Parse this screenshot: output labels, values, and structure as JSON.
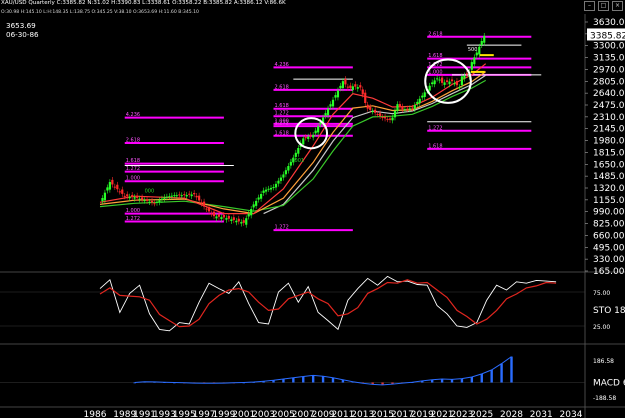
{
  "toolbar": {
    "title": "XAU/USD  Quarterly  C:3385.82  N:31.02  H:3390.83  L:3338.61  O:3358.22  B:3385.82  A:3386.12  V:86.6K",
    "ohlc_strip": "O:30.98  H:145.10  L:H:148.35  L:138.75  O:345.25  V:38.10  O:3653.69  H:11.60  B:345.10",
    "window_buttons": [
      "–",
      "□",
      "×"
    ]
  },
  "corner_labels": {
    "high_value": "3653.69",
    "date": "06-30-86"
  },
  "colors": {
    "background": "#000000",
    "candle_up": "#27ff27",
    "candle_down": "#ff2a2a",
    "fib_level": "#ff00ff",
    "fib_text": "#ff55ff",
    "ma_red": "#ff3b3b",
    "ma_orange": "#ffa13b",
    "ma_green": "#39c82a",
    "ma_white": "#c8c8c8",
    "osc_line": "#ffffff",
    "osc_signal": "#e0261f",
    "macd_up": "#2a6cff",
    "macd_down": "#d83232",
    "price_flag": "#ffffff",
    "yellow_marker": "#ffe400",
    "green_label": "#29d929",
    "grid": "#5a5a5a"
  },
  "chart_data": [
    {
      "type": "candlestick",
      "panel": "price",
      "y_scale": "log",
      "ylim": [
        140,
        3900
      ],
      "yticks": [
        "3630.00",
        "3465.00",
        "3300.00",
        "3135.00",
        "2970.00",
        "2805.00",
        "2640.00",
        "2475.00",
        "2310.00",
        "2145.00",
        "1980.00",
        "1815.00",
        "1650.00",
        "1485.00",
        "1320.00",
        "1155.00",
        "990.00",
        "825.00",
        "660.00",
        "495.00",
        "330.00",
        "165.00"
      ],
      "last_price_label": "3385.82",
      "x_range": [
        1986.5,
        2035
      ],
      "xticks": [
        "1986",
        "1989",
        "1991",
        "1993",
        "1995",
        "1997",
        "1999",
        "2001",
        "2003",
        "2005",
        "2007",
        "2009",
        "2011",
        "2013",
        "2015",
        "2017",
        "2019",
        "2021",
        "2023",
        "2025",
        "2028",
        "2031",
        "2034"
      ],
      "price_path": [
        [
          1986.5,
          345
        ],
        [
          1987.5,
          460
        ],
        [
          1988.2,
          420
        ],
        [
          1989,
          380
        ],
        [
          1990,
          375
        ],
        [
          1991,
          360
        ],
        [
          1992,
          345
        ],
        [
          1993,
          375
        ],
        [
          1994,
          385
        ],
        [
          1995,
          385
        ],
        [
          1996,
          390
        ],
        [
          1997,
          330
        ],
        [
          1998,
          290
        ],
        [
          1999,
          285
        ],
        [
          2000,
          275
        ],
        [
          2001,
          265
        ],
        [
          2002,
          340
        ],
        [
          2003,
          410
        ],
        [
          2004,
          430
        ],
        [
          2005,
          510
        ],
        [
          2006,
          640
        ],
        [
          2007,
          830
        ],
        [
          2008,
          870
        ],
        [
          2009,
          1100
        ],
        [
          2010,
          1400
        ],
        [
          2011,
          1800
        ],
        [
          2011.6,
          1620
        ],
        [
          2012,
          1680
        ],
        [
          2012.8,
          1650
        ],
        [
          2013.4,
          1250
        ],
        [
          2014,
          1200
        ],
        [
          2015,
          1100
        ],
        [
          2015.9,
          1060
        ],
        [
          2016.5,
          1320
        ],
        [
          2017,
          1230
        ],
        [
          2018,
          1250
        ],
        [
          2019,
          1480
        ],
        [
          2020,
          1770
        ],
        [
          2020.6,
          1890
        ],
        [
          2021,
          1760
        ],
        [
          2022,
          1800
        ],
        [
          2022.8,
          1650
        ],
        [
          2023,
          1920
        ],
        [
          2023.7,
          1990
        ],
        [
          2024,
          2330
        ],
        [
          2024.5,
          2650
        ],
        [
          2025,
          3100
        ],
        [
          2025.2,
          3300
        ],
        [
          2025.4,
          3385.82
        ]
      ],
      "ma_red": [
        [
          1986.5,
          350
        ],
        [
          1990,
          380
        ],
        [
          1995,
          370
        ],
        [
          1999,
          300
        ],
        [
          2002,
          300
        ],
        [
          2005,
          420
        ],
        [
          2008,
          750
        ],
        [
          2010,
          1150
        ],
        [
          2012,
          1520
        ],
        [
          2014,
          1430
        ],
        [
          2016,
          1270
        ],
        [
          2018,
          1280
        ],
        [
          2020,
          1450
        ],
        [
          2022,
          1720
        ],
        [
          2024,
          1960
        ],
        [
          2025.4,
          2280
        ]
      ],
      "ma_orange": [
        [
          1986.5,
          340
        ],
        [
          1990,
          360
        ],
        [
          1995,
          365
        ],
        [
          1999,
          320
        ],
        [
          2002,
          300
        ],
        [
          2005,
          370
        ],
        [
          2008,
          600
        ],
        [
          2010,
          900
        ],
        [
          2012,
          1250
        ],
        [
          2014,
          1290
        ],
        [
          2016,
          1210
        ],
        [
          2018,
          1220
        ],
        [
          2020,
          1370
        ],
        [
          2022,
          1580
        ],
        [
          2024,
          1790
        ],
        [
          2025.4,
          2050
        ]
      ],
      "ma_green": [
        [
          1986.5,
          330
        ],
        [
          1990,
          345
        ],
        [
          1995,
          355
        ],
        [
          1999,
          330
        ],
        [
          2002,
          310
        ],
        [
          2005,
          335
        ],
        [
          2008,
          480
        ],
        [
          2010,
          700
        ],
        [
          2012,
          980
        ],
        [
          2014,
          1110
        ],
        [
          2016,
          1120
        ],
        [
          2018,
          1150
        ],
        [
          2020,
          1280
        ],
        [
          2022,
          1460
        ],
        [
          2024,
          1640
        ],
        [
          2025.4,
          1820
        ]
      ],
      "ma_white": [
        [
          2003,
          300
        ],
        [
          2005,
          340
        ],
        [
          2008,
          540
        ],
        [
          2010,
          800
        ],
        [
          2012,
          1100
        ],
        [
          2014,
          1200
        ],
        [
          2016,
          1160
        ],
        [
          2018,
          1200
        ],
        [
          2020,
          1330
        ],
        [
          2022,
          1520
        ],
        [
          2024,
          1720
        ],
        [
          2025.4,
          1950
        ]
      ],
      "fib_levels_left": [
        {
          "label": "4.236",
          "price": 1100,
          "x0": 1989,
          "x1": 1999
        },
        {
          "label": "2.618",
          "price": 780,
          "x0": 1989,
          "x1": 1999
        },
        {
          "label": "1.618",
          "price": 590,
          "x0": 1989,
          "x1": 1999
        },
        {
          "label": "1.272",
          "price": 530,
          "x0": 1989,
          "x1": 1999
        },
        {
          "label": "1.000",
          "price": 465,
          "x0": 1989,
          "x1": 1999
        },
        {
          "label": "1.000",
          "price": 300,
          "x0": 1989,
          "x1": 1999
        },
        {
          "label": "1.272",
          "price": 270,
          "x0": 1989,
          "x1": 1999
        }
      ],
      "fib_levels_mid": [
        {
          "label": "4.236",
          "price": 2170,
          "x0": 2004,
          "x1": 2012
        },
        {
          "label": "2.618",
          "price": 1600,
          "x0": 2004,
          "x1": 2012
        },
        {
          "label": "1.618",
          "price": 1240,
          "x0": 2004,
          "x1": 2012
        },
        {
          "label": "1.272",
          "price": 1120,
          "x0": 2004,
          "x1": 2012
        },
        {
          "label": "1.000",
          "price": 1010,
          "x0": 2004,
          "x1": 2012
        },
        {
          "label": "1.272",
          "price": 980,
          "x0": 2004,
          "x1": 2012
        },
        {
          "label": "1.618",
          "price": 860,
          "x0": 2004,
          "x1": 2012
        },
        {
          "label": "1.272",
          "price": 240,
          "x0": 2004,
          "x1": 2012
        }
      ],
      "fib_levels_right": [
        {
          "label": "2.618",
          "price": 3280,
          "x0": 2019.5,
          "x1": 2030
        },
        {
          "label": "1.618",
          "price": 2440,
          "x0": 2019.5,
          "x1": 2030
        },
        {
          "label": "1.272",
          "price": 2170,
          "x0": 2019.5,
          "x1": 2030
        },
        {
          "label": "1.000",
          "price": 1960,
          "x0": 2019.5,
          "x1": 2030
        },
        {
          "label": "1.272",
          "price": 920,
          "x0": 2019.5,
          "x1": 2030
        },
        {
          "label": "1.618",
          "price": 720,
          "x0": 2019.5,
          "x1": 2030
        }
      ],
      "white_levels": [
        {
          "label": "500",
          "price": 2930,
          "x0": 2023.5,
          "x1": 2029
        },
        {
          "label": "",
          "price": 1960,
          "x0": 2022,
          "x1": 2031
        },
        {
          "label": "",
          "price": 1040,
          "x0": 2019.5,
          "x1": 2030
        },
        {
          "label": "",
          "price": 1850,
          "x0": 2006,
          "x1": 2012
        },
        {
          "label": "",
          "price": 575,
          "x0": 1989,
          "x1": 2000
        }
      ],
      "green_labels": [
        {
          "text": "000",
          "year": 1991,
          "price": 400
        },
        {
          "text": "0001",
          "year": 2005.8,
          "price": 605
        }
      ],
      "circles": [
        {
          "year": 2007.8,
          "price": 890,
          "rx_years": 1.6
        },
        {
          "year": 2021.6,
          "price": 1800,
          "rx_years": 2.3
        }
      ],
      "yellow_markers": [
        {
          "year": 2024.8,
          "price": 2560
        },
        {
          "year": 2023.9,
          "price": 2040
        }
      ]
    },
    {
      "type": "line",
      "panel": "stochastic",
      "label": "STO 18",
      "ylim": [
        0,
        100
      ],
      "levels": [
        "75.00",
        "25.00"
      ],
      "k_values": [
        80,
        90,
        45,
        70,
        85,
        40,
        20,
        15,
        30,
        25,
        60,
        85,
        80,
        70,
        90,
        55,
        30,
        25,
        75,
        85,
        60,
        80,
        45,
        30,
        20,
        60,
        80,
        92,
        85,
        95,
        90,
        88,
        86,
        82,
        55,
        40,
        25,
        20,
        30,
        60,
        85,
        75,
        90,
        85,
        92,
        88,
        90
      ],
      "d_values": [
        72,
        78,
        70,
        66,
        68,
        60,
        42,
        30,
        24,
        22,
        35,
        55,
        70,
        75,
        80,
        72,
        60,
        45,
        50,
        62,
        70,
        72,
        65,
        55,
        40,
        40,
        52,
        70,
        80,
        86,
        88,
        90,
        88,
        86,
        78,
        64,
        48,
        36,
        28,
        32,
        48,
        62,
        72,
        78,
        84,
        86,
        88
      ],
      "x_start": 1986.5,
      "x_step": 1
    },
    {
      "type": "bar+line",
      "panel": "macd",
      "label": "MACD 6",
      "level_labels": [
        "186.58",
        "-188.58"
      ],
      "macd_line": [
        0,
        5,
        4,
        2,
        0,
        -2,
        -4,
        -5,
        -5,
        -4,
        -2,
        0,
        3,
        8,
        14,
        22,
        30,
        38,
        45,
        40,
        30,
        18,
        5,
        -5,
        -12,
        -15,
        -10,
        -4,
        2,
        10,
        18,
        22,
        20,
        25,
        35,
        55,
        80,
        120,
        165
      ],
      "x_start": 1990,
      "x_step": 1
    }
  ]
}
